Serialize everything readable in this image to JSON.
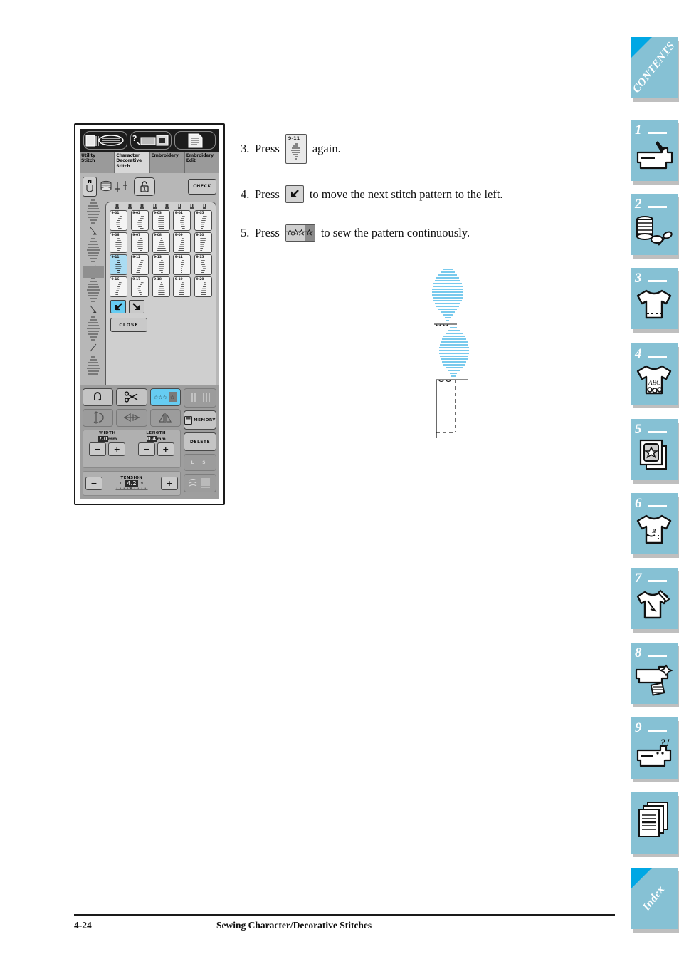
{
  "page": {
    "footer_page_number": "4-24",
    "footer_title": "Sewing Character/Decorative Stitches"
  },
  "colors": {
    "tab_background": "#86c1d4",
    "tab_corner": "#00a7e4",
    "stitch_illustration": "#29ABE2",
    "lcd_selected": "#aadcf2",
    "lcd_panel": "#b7b7b7"
  },
  "steps": [
    {
      "number": "3.",
      "text_before": "Press",
      "button": "9-11",
      "button_kind": "stitch-911",
      "text_after": "again."
    },
    {
      "number": "4.",
      "text_before": "Press",
      "button": "",
      "button_kind": "arrow-left-down",
      "text_after": "to move the next stitch pattern to the left."
    },
    {
      "number": "5.",
      "text_before": "Press",
      "button": "",
      "button_kind": "continuous-sew",
      "text_after": "to sew the pattern continuously."
    }
  ],
  "lcd": {
    "top_icons": [
      "stitch-chart-icon",
      "machine-help-icon",
      "manual-list-icon"
    ],
    "tabs": [
      {
        "label": "Utility\nStitch",
        "line1": "Utility",
        "line2": "Stitch",
        "line3": "",
        "active": false
      },
      {
        "label": "Character Decorative Stitch",
        "line1": "Character",
        "line2": "Decorative",
        "line3": "Stitch",
        "active": true
      },
      {
        "label": "Embroidery",
        "line1": "Embroidery",
        "line2": "",
        "line3": "",
        "active": false
      },
      {
        "label": "Embroidery Edit",
        "line1": "Embroidery",
        "line2": "Edit",
        "line3": "",
        "active": false
      }
    ],
    "presser_foot": "N",
    "check_label": "CHECK",
    "close_label": "CLOSE",
    "grid": [
      [
        {
          "id": "9-01",
          "selected": false
        },
        {
          "id": "9-02",
          "selected": false
        },
        {
          "id": "9-03",
          "selected": false
        },
        {
          "id": "9-04",
          "selected": false
        },
        {
          "id": "9-05",
          "selected": false
        }
      ],
      [
        {
          "id": "9-06",
          "selected": false
        },
        {
          "id": "9-07",
          "selected": false
        },
        {
          "id": "9-08",
          "selected": false
        },
        {
          "id": "9-09",
          "selected": false
        },
        {
          "id": "9-10",
          "selected": false
        }
      ],
      [
        {
          "id": "9-11",
          "selected": true
        },
        {
          "id": "9-12",
          "selected": false
        },
        {
          "id": "9-13",
          "selected": false
        },
        {
          "id": "9-14",
          "selected": false
        },
        {
          "id": "9-15",
          "selected": false
        }
      ],
      [
        {
          "id": "9-16",
          "selected": false
        },
        {
          "id": "9-17",
          "selected": false
        },
        {
          "id": "9-18",
          "selected": false
        },
        {
          "id": "9-19",
          "selected": false
        },
        {
          "id": "9-20",
          "selected": false
        }
      ]
    ],
    "arrows": [
      {
        "name": "move-left-down",
        "selected": true
      },
      {
        "name": "move-right-down",
        "selected": false
      }
    ],
    "settings": {
      "width_label": "WIDTH",
      "width_value": "7.0",
      "width_unit": "mm",
      "length_label": "LENGTH",
      "length_value": "0.4",
      "length_unit": "mm",
      "tension_label": "TENSION",
      "tension_value": "4.2",
      "tension_min": "0",
      "tension_max": "9",
      "minus": "−",
      "plus": "+"
    },
    "right_buttons": [
      {
        "label": "",
        "name": "twin-needle-button",
        "dim": true
      },
      {
        "label": "MEMORY",
        "name": "memory-button",
        "dim": false
      },
      {
        "label": "DELETE",
        "name": "delete-button",
        "dim": false
      },
      {
        "label": "L    S",
        "name": "size-ls-button",
        "dim": true
      },
      {
        "label": "",
        "name": "stitch-density-button",
        "dim": true
      }
    ],
    "function_buttons": [
      {
        "name": "reverse-stitch-button",
        "highlighted": false,
        "dim": false
      },
      {
        "name": "thread-cutter-button",
        "highlighted": false,
        "dim": false
      },
      {
        "name": "continuous-sewing-button",
        "highlighted": true,
        "dim": false
      },
      {
        "name": "elongation-button",
        "highlighted": false,
        "dim": true
      },
      {
        "name": "horizontal-mirror-button",
        "highlighted": false,
        "dim": true
      },
      {
        "name": "vertical-mirror-button",
        "highlighted": false,
        "dim": true
      }
    ]
  },
  "sidebar": {
    "contents_label": "CONTENTS",
    "index_label": "Index",
    "tabs": [
      {
        "number": "1",
        "icon": "sewing-machine-icon"
      },
      {
        "number": "2",
        "icon": "thread-spool-bobbin-icon"
      },
      {
        "number": "3",
        "icon": "tshirt-hem-icon"
      },
      {
        "number": "4",
        "icon": "tshirt-abc-icon"
      },
      {
        "number": "5",
        "icon": "embroidery-card-icon"
      },
      {
        "number": "6",
        "icon": "tshirt-edit-icon"
      },
      {
        "number": "7",
        "icon": "tshirt-needle-icon"
      },
      {
        "number": "8",
        "icon": "machine-maintenance-icon"
      },
      {
        "number": "9",
        "icon": "machine-question-icon"
      },
      {
        "number": "",
        "icon": "appendix-pages-icon"
      }
    ]
  }
}
